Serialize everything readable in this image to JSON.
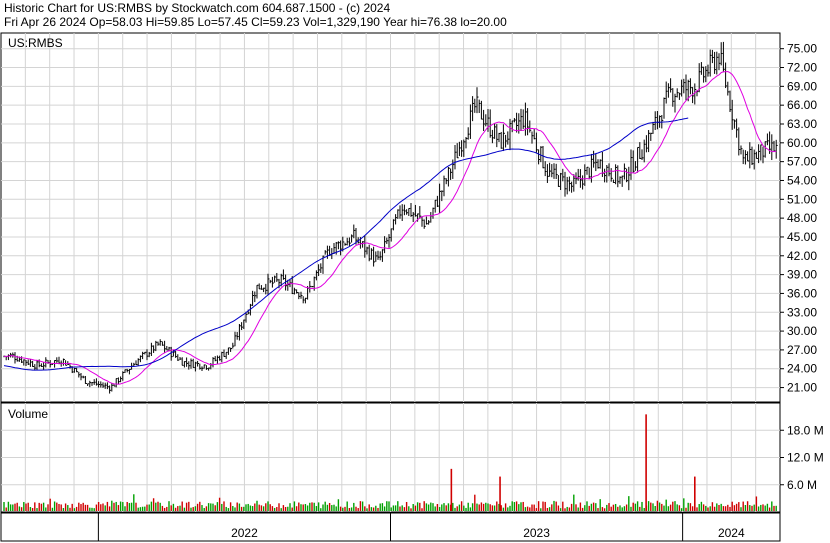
{
  "header": {
    "title": "Historic Chart for US:RMBS by Stockwatch.com 604.687.1500 - (c) 2024",
    "stats": "Fri Apr 26 2024   Op=58.03   Hi=59.85   Lo=57.45   Cl=59.23   Vol=1,329,190   Year hi=76.38   lo=20.00"
  },
  "chart_data": [
    {
      "type": "ohlc",
      "symbol_label": "US:RMBS",
      "last_bar": {
        "date": "Fri Apr 26 2024",
        "open": 58.03,
        "high": 59.85,
        "low": 57.45,
        "close": 59.23,
        "volume": 1329190
      },
      "year_high": 76.38,
      "year_low": 20.0,
      "y_ticks": [
        "75.00",
        "72.00",
        "69.00",
        "66.00",
        "63.00",
        "60.00",
        "57.00",
        "54.00",
        "51.00",
        "48.00",
        "45.00",
        "42.00",
        "39.00",
        "36.00",
        "33.00",
        "30.00",
        "27.00",
        "24.00",
        "21.00"
      ],
      "ylim": [
        18.7,
        77.5
      ],
      "x_ticks": [
        "2022",
        "2023",
        "2024"
      ],
      "x_range": [
        "2021-09",
        "2024-04"
      ],
      "close_path": [
        [
          "2021-09",
          26
        ],
        [
          "2021-10",
          24.5
        ],
        [
          "2021-11",
          25.5
        ],
        [
          "2021-12",
          22
        ],
        [
          "2022-01",
          21
        ],
        [
          "2022-02",
          25
        ],
        [
          "2022-03",
          28
        ],
        [
          "2022-04",
          25
        ],
        [
          "2022-05",
          24.5
        ],
        [
          "2022-06",
          27.5
        ],
        [
          "2022-07",
          37
        ],
        [
          "2022-08",
          38
        ],
        [
          "2022-09",
          35.5
        ],
        [
          "2022-10",
          43
        ],
        [
          "2022-11",
          45
        ],
        [
          "2022-12",
          41
        ],
        [
          "2023-01",
          50
        ],
        [
          "2023-02",
          47
        ],
        [
          "2023-03",
          56
        ],
        [
          "2023-04",
          66
        ],
        [
          "2023-05",
          60
        ],
        [
          "2023-06",
          64
        ],
        [
          "2023-07",
          55
        ],
        [
          "2023-08",
          53
        ],
        [
          "2023-09",
          57
        ],
        [
          "2023-10",
          54
        ],
        [
          "2023-11",
          60
        ],
        [
          "2023-12",
          68
        ],
        [
          "2024-01",
          69
        ],
        [
          "2024-02",
          74
        ],
        [
          "2024-03",
          57
        ],
        [
          "2024-04",
          59
        ]
      ],
      "series": [
        {
          "name": "",
          "style": "ohlc-bars",
          "color": "#000000"
        },
        {
          "name": "",
          "style": "short-moving-average",
          "color": "#e000e0"
        },
        {
          "name": "",
          "style": "long-moving-average",
          "color": "#0000c8"
        }
      ],
      "grid": true
    },
    {
      "type": "bar",
      "panel_label": "Volume",
      "y_ticks": [
        "18.0 M",
        "12.0 M",
        "6.0 M"
      ],
      "ylim": [
        0,
        24
      ],
      "unit": "M",
      "colors": {
        "up": "#00a000",
        "down": "#d00000"
      },
      "spikes": [
        {
          "date": "2023-03",
          "value": 9.5,
          "color": "#d00000"
        },
        {
          "date": "2023-05",
          "value": 7.8,
          "color": "#d00000"
        },
        {
          "date": "2023-11",
          "value": 21.5,
          "color": "#d00000"
        },
        {
          "date": "2024-01",
          "value": 7.8,
          "color": "#d00000"
        }
      ],
      "grid": true
    }
  ]
}
